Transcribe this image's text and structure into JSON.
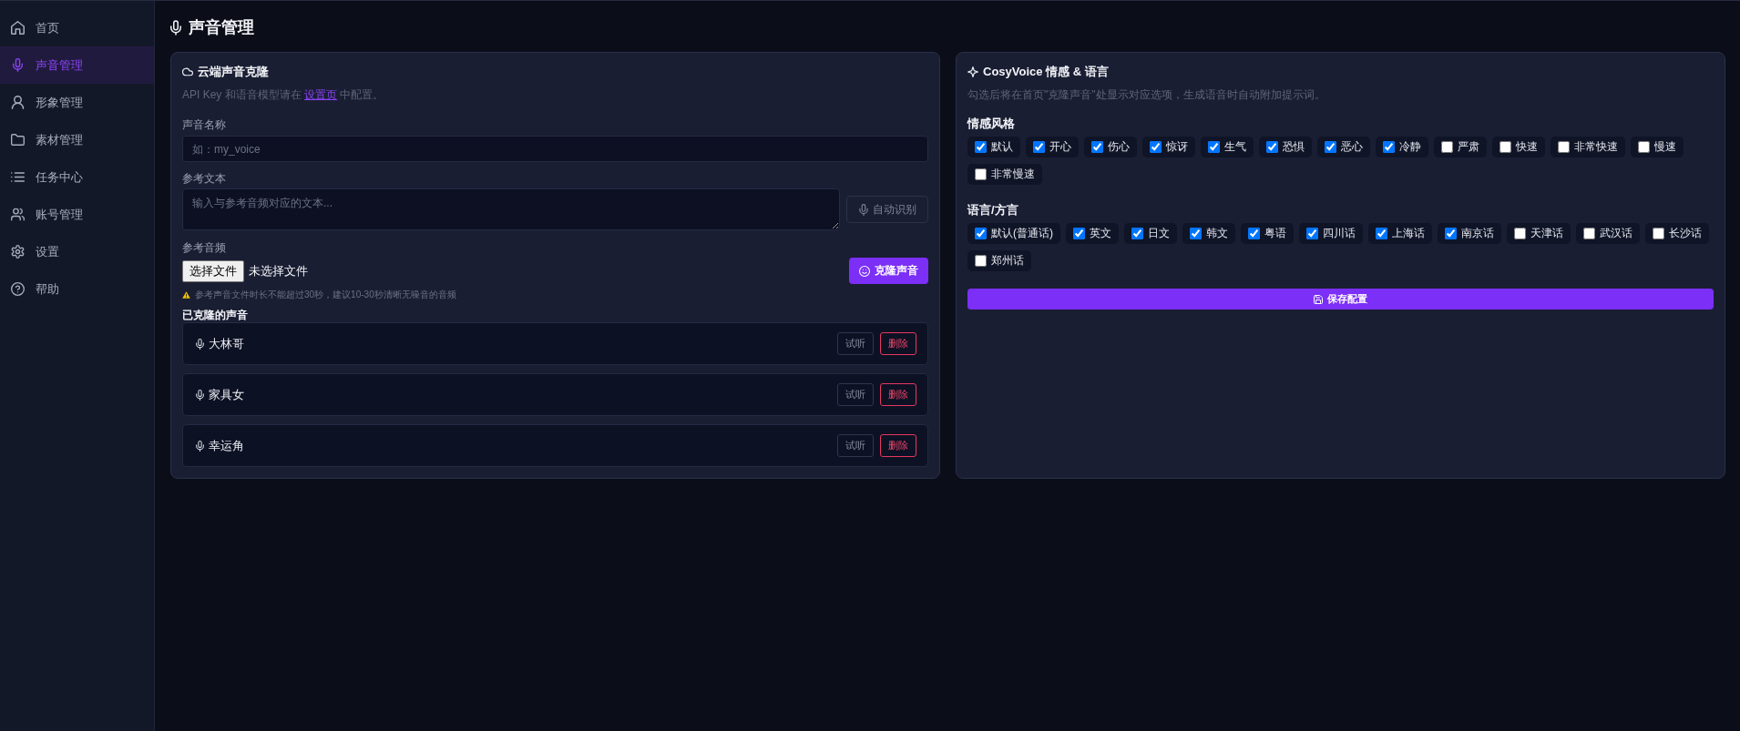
{
  "sidebar": {
    "items": [
      {
        "label": "首页",
        "selected": false
      },
      {
        "label": "声音管理",
        "selected": true
      },
      {
        "label": "形象管理",
        "selected": false
      },
      {
        "label": "素材管理",
        "selected": false
      },
      {
        "label": "任务中心",
        "selected": false
      },
      {
        "label": "账号管理",
        "selected": false
      },
      {
        "label": "设置",
        "selected": false
      },
      {
        "label": "帮助",
        "selected": false
      }
    ]
  },
  "header": {
    "title": "声音管理"
  },
  "clone_card": {
    "title": "云端声音克隆",
    "hint": {
      "text_before": "API Key 和语音模型请在",
      "link": "设置页",
      "text_after": "中配置。"
    },
    "voice_name": {
      "label": "声音名称",
      "placeholder": "如：my_voice"
    },
    "reference_text": {
      "label": "参考文本",
      "placeholder": "输入与参考音频对应的文本...",
      "button": "自动识别"
    },
    "reference_audio": {
      "label": "参考音频",
      "file_button": "选择文件",
      "file_status": "未选择文件",
      "clone_button": "克隆声音",
      "warning": "参考声音文件时长不能超过30秒，建议10-30秒清晰无噪音的音频"
    },
    "cloned_voices": {
      "title": "已克隆的声音",
      "items": [
        {
          "name": "大林哥",
          "preview_button": "试听",
          "delete_button": "删除"
        },
        {
          "name": "家具女",
          "preview_button": "试听",
          "delete_button": "删除"
        },
        {
          "name": "幸运角",
          "preview_button": "试听",
          "delete_button": "删除"
        }
      ]
    }
  },
  "cosyvoice_card": {
    "title": "CosyVoice 情感 & 语言",
    "description": "勾选后将在首页\"克隆声音\"处显示对应选项，生成语音时自动附加提示词。",
    "emotion_section": {
      "title": "情感风格",
      "options": [
        {
          "label": "默认",
          "checked": true
        },
        {
          "label": "开心",
          "checked": true
        },
        {
          "label": "伤心",
          "checked": true
        },
        {
          "label": "惊讶",
          "checked": true
        },
        {
          "label": "生气",
          "checked": true
        },
        {
          "label": "恐惧",
          "checked": true
        },
        {
          "label": "恶心",
          "checked": true
        },
        {
          "label": "冷静",
          "checked": true
        },
        {
          "label": "严肃",
          "checked": false
        },
        {
          "label": "快速",
          "checked": false
        },
        {
          "label": "非常快速",
          "checked": false
        },
        {
          "label": "慢速",
          "checked": false
        },
        {
          "label": "非常慢速",
          "checked": false
        }
      ]
    },
    "language_section": {
      "title": "语言/方言",
      "options": [
        {
          "label": "默认(普通话)",
          "checked": true
        },
        {
          "label": "英文",
          "checked": true
        },
        {
          "label": "日文",
          "checked": true
        },
        {
          "label": "韩文",
          "checked": true
        },
        {
          "label": "粤语",
          "checked": true
        },
        {
          "label": "四川话",
          "checked": true
        },
        {
          "label": "上海话",
          "checked": true
        },
        {
          "label": "南京话",
          "checked": true
        },
        {
          "label": "天津话",
          "checked": false
        },
        {
          "label": "武汉话",
          "checked": false
        },
        {
          "label": "长沙话",
          "checked": false
        },
        {
          "label": "郑州话",
          "checked": false
        }
      ]
    },
    "save_button": "保存配置"
  }
}
